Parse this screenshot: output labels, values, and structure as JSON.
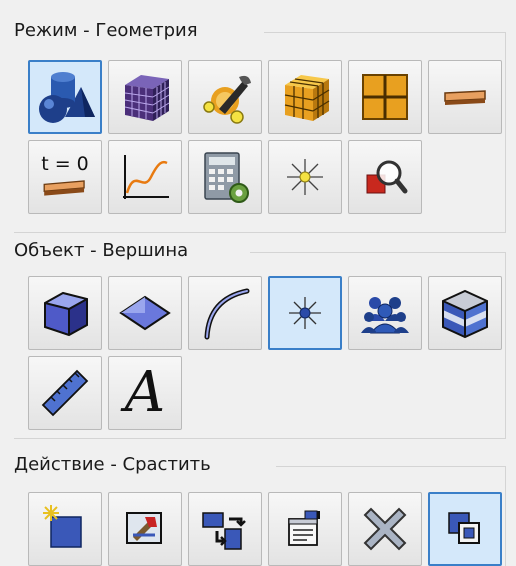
{
  "groups": [
    {
      "title": "Режим - Геометрия"
    },
    {
      "title": "Объект - Вершина"
    },
    {
      "title": "Действие - Срастить"
    }
  ],
  "mode_buttons": [
    {
      "icon": "geometry-icon",
      "selected": true
    },
    {
      "icon": "mesh-icon",
      "selected": false
    },
    {
      "icon": "tools-icon",
      "selected": false
    },
    {
      "icon": "block-mesh-icon",
      "selected": false
    },
    {
      "icon": "grid-icon",
      "selected": false
    },
    {
      "icon": "strip-icon",
      "selected": false
    },
    {
      "icon": "time-zero-icon",
      "label": "t = 0",
      "selected": false
    },
    {
      "icon": "plot-curve-icon",
      "selected": false
    },
    {
      "icon": "calculator-icon",
      "selected": false
    },
    {
      "icon": "light-icon",
      "selected": false
    },
    {
      "icon": "inspect-icon",
      "selected": false
    }
  ],
  "object_buttons": [
    {
      "icon": "volume-icon",
      "selected": false
    },
    {
      "icon": "face-icon",
      "selected": false
    },
    {
      "icon": "edge-icon",
      "selected": false
    },
    {
      "icon": "vertex-icon",
      "selected": true
    },
    {
      "icon": "group-icon",
      "selected": false
    },
    {
      "icon": "cube-section-icon",
      "selected": false
    },
    {
      "icon": "ruler-icon",
      "selected": false
    },
    {
      "icon": "text-icon",
      "label": "A",
      "selected": false
    }
  ],
  "action_buttons": [
    {
      "icon": "create-icon",
      "selected": false
    },
    {
      "icon": "edit-icon",
      "selected": false
    },
    {
      "icon": "transform-icon",
      "selected": false
    },
    {
      "icon": "properties-icon",
      "selected": false
    },
    {
      "icon": "delete-icon",
      "selected": false
    },
    {
      "icon": "merge-icon",
      "selected": true
    }
  ],
  "colors": {
    "accent": "#3a7fc8",
    "selected_bg": "#d4e8fa",
    "icon_blue": "#1e3f8a",
    "orange": "#e8a020"
  }
}
